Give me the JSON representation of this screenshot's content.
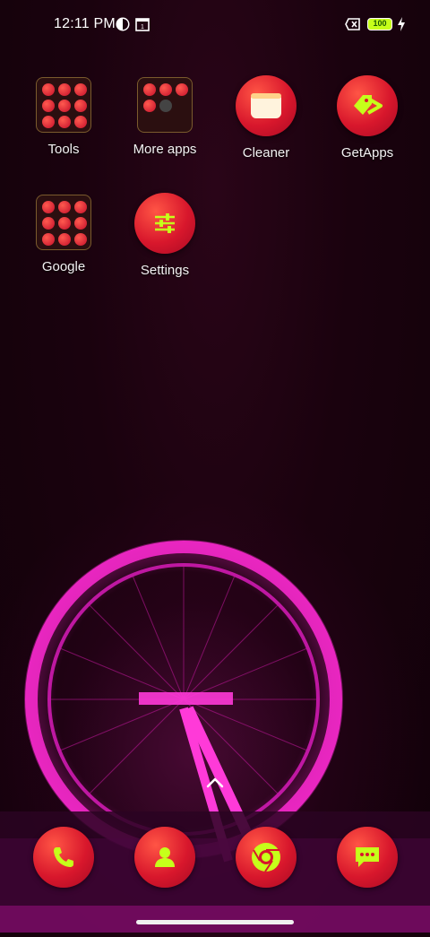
{
  "status_bar": {
    "time": "12:11 PM",
    "battery_level": "100",
    "icons": [
      "data-saver-icon",
      "calendar-icon",
      "no-sim-icon",
      "battery-icon",
      "charging-bolt-icon"
    ],
    "accent_color": "#c6ff1a"
  },
  "home": {
    "row1": [
      {
        "label": "Tools",
        "type": "folder"
      },
      {
        "label": "More apps",
        "type": "folder"
      },
      {
        "label": "Cleaner",
        "type": "app"
      },
      {
        "label": "GetApps",
        "type": "app"
      }
    ],
    "row2": [
      {
        "label": "Google",
        "type": "folder"
      },
      {
        "label": "Settings",
        "type": "app"
      }
    ]
  },
  "dock": [
    {
      "name": "phone-icon"
    },
    {
      "name": "contacts-icon"
    },
    {
      "name": "chrome-icon"
    },
    {
      "name": "messages-icon"
    }
  ],
  "colors": {
    "icon_red": "#d8172c",
    "icon_glyph": "#c6ff1a",
    "wallpaper_pink": "#ff2ad4"
  }
}
